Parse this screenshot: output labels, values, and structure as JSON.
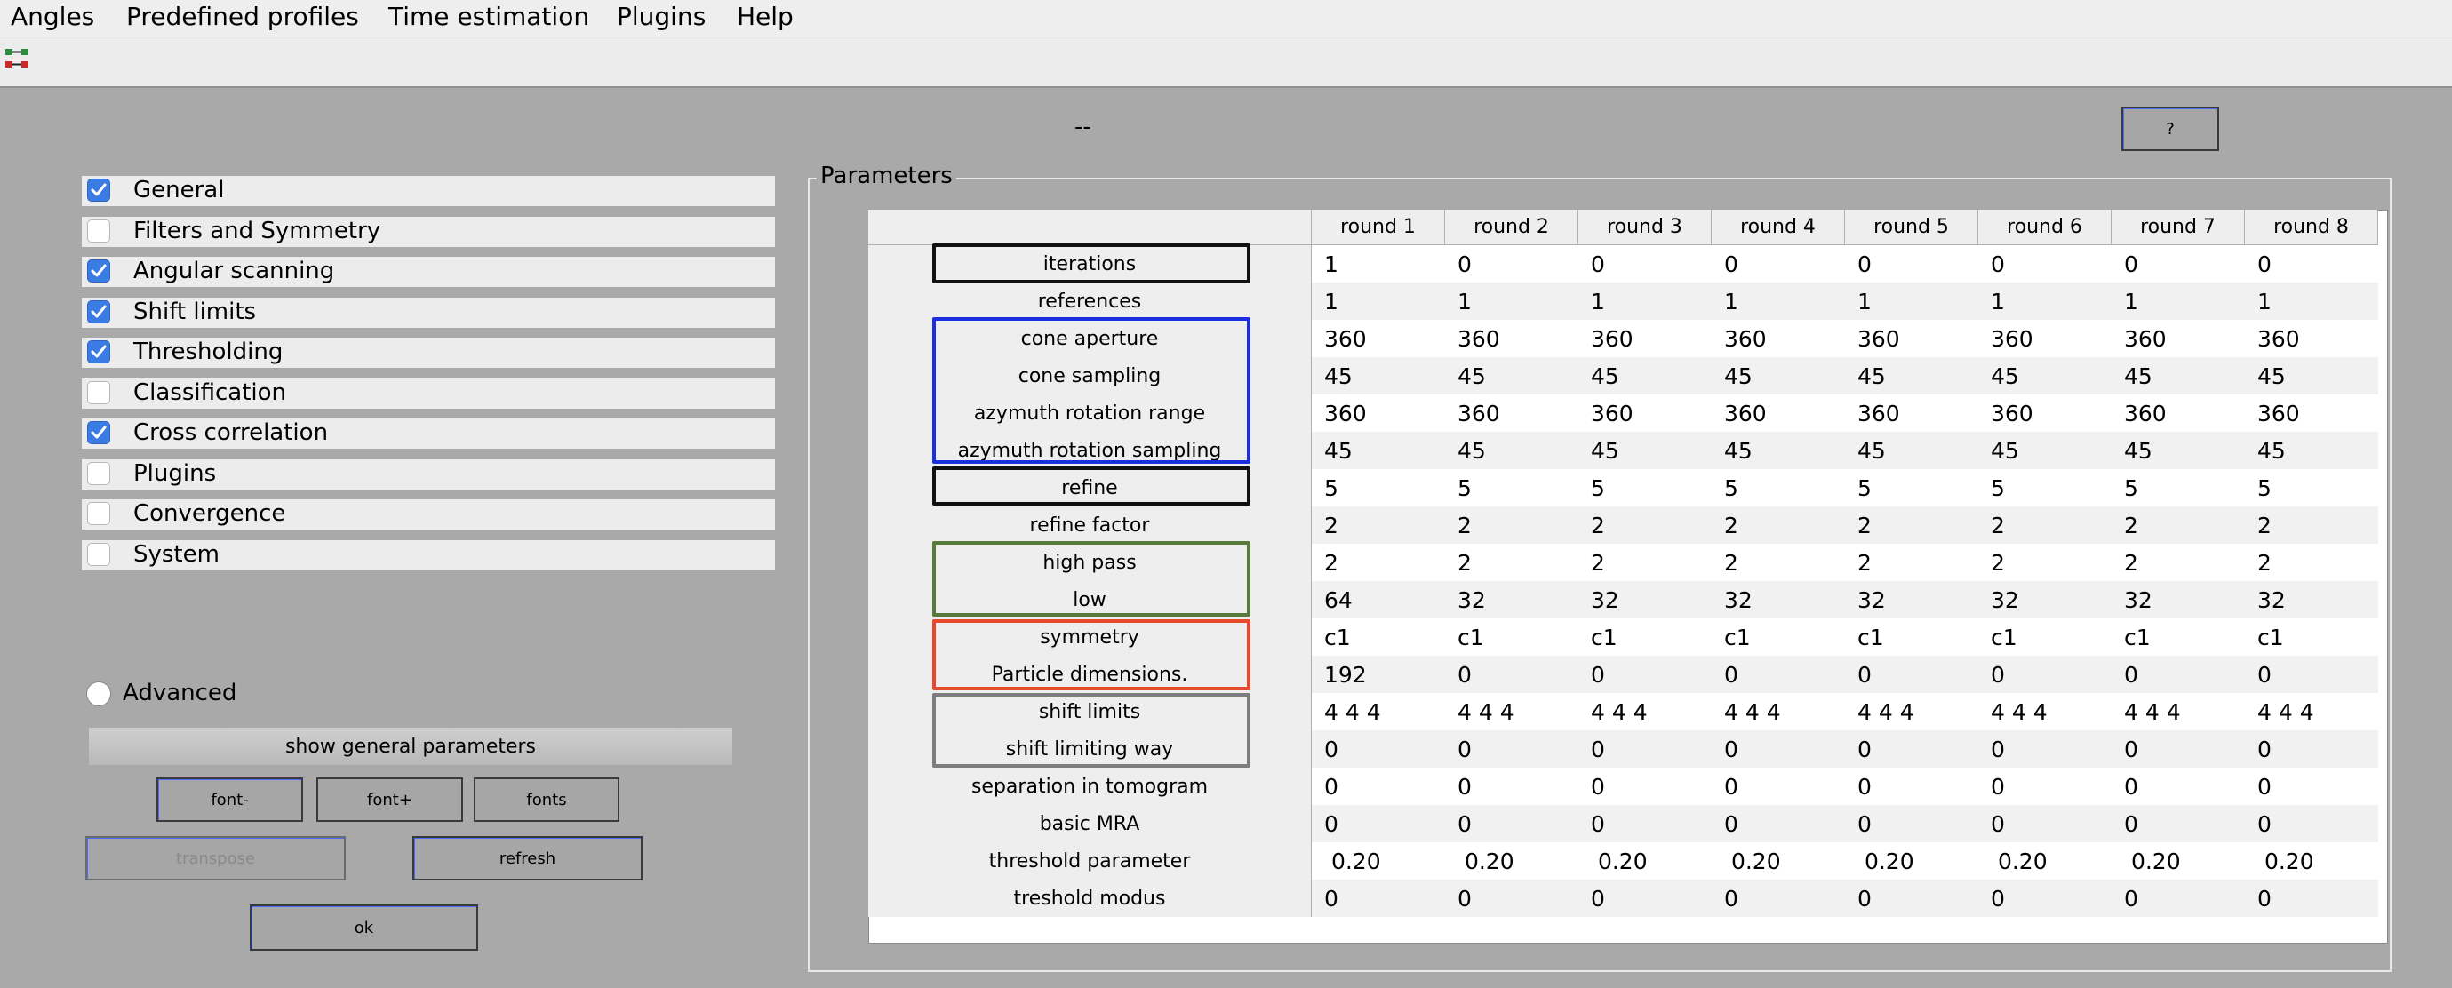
{
  "menubar": {
    "items": [
      "Angles",
      "Predefined profiles",
      "Time estimation",
      "Plugins",
      "Help"
    ]
  },
  "toolbar": {
    "icon": "connection-icon"
  },
  "status_text": "--",
  "help_button": "?",
  "categories": [
    {
      "label": "General",
      "checked": true
    },
    {
      "label": "Filters and Symmetry",
      "checked": false
    },
    {
      "label": "Angular scanning",
      "checked": true
    },
    {
      "label": "Shift limits",
      "checked": true
    },
    {
      "label": "Thresholding",
      "checked": true
    },
    {
      "label": "Classification",
      "checked": false
    },
    {
      "label": "Cross correlation",
      "checked": true
    },
    {
      "label": "Plugins",
      "checked": false
    },
    {
      "label": "Convergence",
      "checked": false
    },
    {
      "label": "System",
      "checked": false
    }
  ],
  "advanced": {
    "label": "Advanced",
    "selected": false
  },
  "show_general": "show general parameters",
  "buttons": {
    "font_minus": "font-",
    "font_plus": "font+",
    "fonts": "fonts",
    "transpose": "transpose",
    "refresh": "refresh",
    "ok": "ok"
  },
  "parameters": {
    "title": "Parameters",
    "columns": [
      "round 1",
      "round 2",
      "round 3",
      "round 4",
      "round 5",
      "round 6",
      "round 7",
      "round 8"
    ],
    "rows": [
      {
        "label": "iterations",
        "values": [
          "1",
          "0",
          "0",
          "0",
          "0",
          "0",
          "0",
          "0"
        ]
      },
      {
        "label": "references",
        "values": [
          "1",
          "1",
          "1",
          "1",
          "1",
          "1",
          "1",
          "1"
        ]
      },
      {
        "label": "cone aperture",
        "values": [
          "360",
          "360",
          "360",
          "360",
          "360",
          "360",
          "360",
          "360"
        ]
      },
      {
        "label": "cone sampling",
        "values": [
          "45",
          "45",
          "45",
          "45",
          "45",
          "45",
          "45",
          "45"
        ]
      },
      {
        "label": "azymuth rotation range",
        "values": [
          "360",
          "360",
          "360",
          "360",
          "360",
          "360",
          "360",
          "360"
        ]
      },
      {
        "label": "azymuth rotation sampling",
        "values": [
          "45",
          "45",
          "45",
          "45",
          "45",
          "45",
          "45",
          "45"
        ]
      },
      {
        "label": "refine",
        "values": [
          "5",
          "5",
          "5",
          "5",
          "5",
          "5",
          "5",
          "5"
        ]
      },
      {
        "label": "refine factor",
        "values": [
          "2",
          "2",
          "2",
          "2",
          "2",
          "2",
          "2",
          "2"
        ]
      },
      {
        "label": "high pass",
        "values": [
          "2",
          "2",
          "2",
          "2",
          "2",
          "2",
          "2",
          "2"
        ]
      },
      {
        "label": "low",
        "values": [
          "64",
          "32",
          "32",
          "32",
          "32",
          "32",
          "32",
          "32"
        ]
      },
      {
        "label": "symmetry",
        "values": [
          "c1",
          "c1",
          "c1",
          "c1",
          "c1",
          "c1",
          "c1",
          "c1"
        ]
      },
      {
        "label": "Particle dimensions.",
        "values": [
          "192",
          "0",
          "0",
          "0",
          "0",
          "0",
          "0",
          "0"
        ]
      },
      {
        "label": "shift limits",
        "values": [
          "4 4 4",
          "4 4 4",
          "4 4 4",
          "4 4 4",
          "4 4 4",
          "4 4 4",
          "4 4 4",
          "4 4 4"
        ]
      },
      {
        "label": "shift limiting way",
        "values": [
          "0",
          "0",
          "0",
          "0",
          "0",
          "0",
          "0",
          "0"
        ]
      },
      {
        "label": "separation in tomogram",
        "values": [
          "0",
          "0",
          "0",
          "0",
          "0",
          "0",
          "0",
          "0"
        ]
      },
      {
        "label": "basic MRA",
        "values": [
          "0",
          "0",
          "0",
          "0",
          "0",
          "0",
          "0",
          "0"
        ]
      },
      {
        "label": "threshold parameter",
        "values": [
          " 0.20",
          " 0.20",
          " 0.20",
          " 0.20",
          " 0.20",
          " 0.20",
          " 0.20",
          " 0.20"
        ]
      },
      {
        "label": "treshold modus",
        "values": [
          "0",
          "0",
          "0",
          "0",
          "0",
          "0",
          "0",
          "0"
        ]
      }
    ]
  },
  "group_colors": {
    "black": "#111111",
    "blue": "#1a2fe0",
    "green": "#587a3a",
    "red": "#e8492a",
    "gray": "#7d7d7d"
  }
}
